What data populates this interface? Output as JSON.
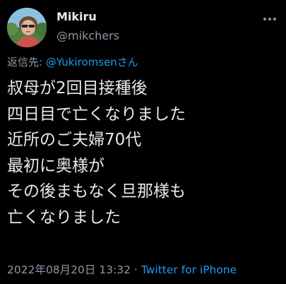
{
  "user": {
    "display_name": "Mikiru",
    "handle": "@mikchers"
  },
  "reply": {
    "prefix": "返信先: ",
    "mention": "@Yukiromsenさん"
  },
  "body": {
    "lines": [
      "叔母が2回目接種後",
      "四日目で亡くなりました",
      "近所のご夫婦70代",
      "最初に奥様が",
      "その後まもなく旦那様も",
      "亡くなりました"
    ]
  },
  "meta": {
    "timestamp": "2022年08月20日 13:32",
    "separator": " · ",
    "source": "Twitter for iPhone"
  },
  "icons": {
    "more": "more-horizontal-icon",
    "avatar": "profile-photo"
  },
  "colors": {
    "background": "#000000",
    "text": "#e7e9ea",
    "secondary": "#8b98a5",
    "link": "#1d9bf0"
  }
}
